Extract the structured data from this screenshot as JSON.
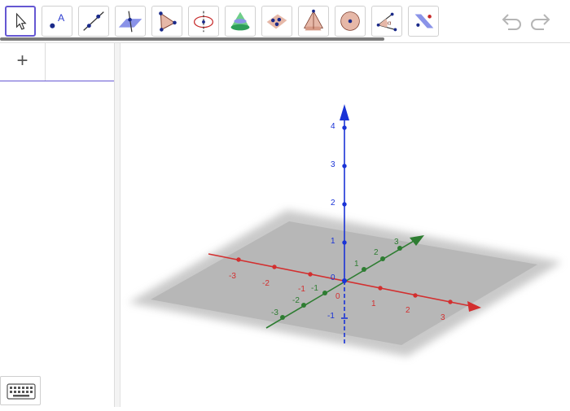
{
  "toolbar": {
    "tools": [
      {
        "name": "move-tool-icon",
        "active": true
      },
      {
        "name": "point-tool-icon"
      },
      {
        "name": "line-tool-icon"
      },
      {
        "name": "perpendicular-line-tool-icon"
      },
      {
        "name": "polygon-tool-icon"
      },
      {
        "name": "circle-axis-tool-icon"
      },
      {
        "name": "cone-tool-icon"
      },
      {
        "name": "plane-through-points-tool-icon"
      },
      {
        "name": "pyramid-tool-icon"
      },
      {
        "name": "sphere-tool-icon"
      },
      {
        "name": "angle-tool-icon"
      },
      {
        "name": "reflect-tool-icon"
      }
    ],
    "undo_icon": "undo-icon",
    "redo_icon": "redo-icon"
  },
  "algebra": {
    "add_label": "+"
  },
  "graphics3d": {
    "axes": {
      "x": {
        "color": "#d32f2f",
        "ticks": [
          "-3",
          "-2",
          "-1",
          "0",
          "1",
          "2",
          "3"
        ]
      },
      "y": {
        "color": "#2e7d32",
        "ticks": [
          "-3",
          "-2",
          "-1",
          "1",
          "2",
          "3"
        ]
      },
      "z": {
        "color": "#1a33d6",
        "ticks": [
          "-1",
          "0",
          "1",
          "2",
          "3",
          "4"
        ]
      }
    },
    "plane_color": "#9e9e9e"
  },
  "keyboard_icon": "keyboard-icon"
}
